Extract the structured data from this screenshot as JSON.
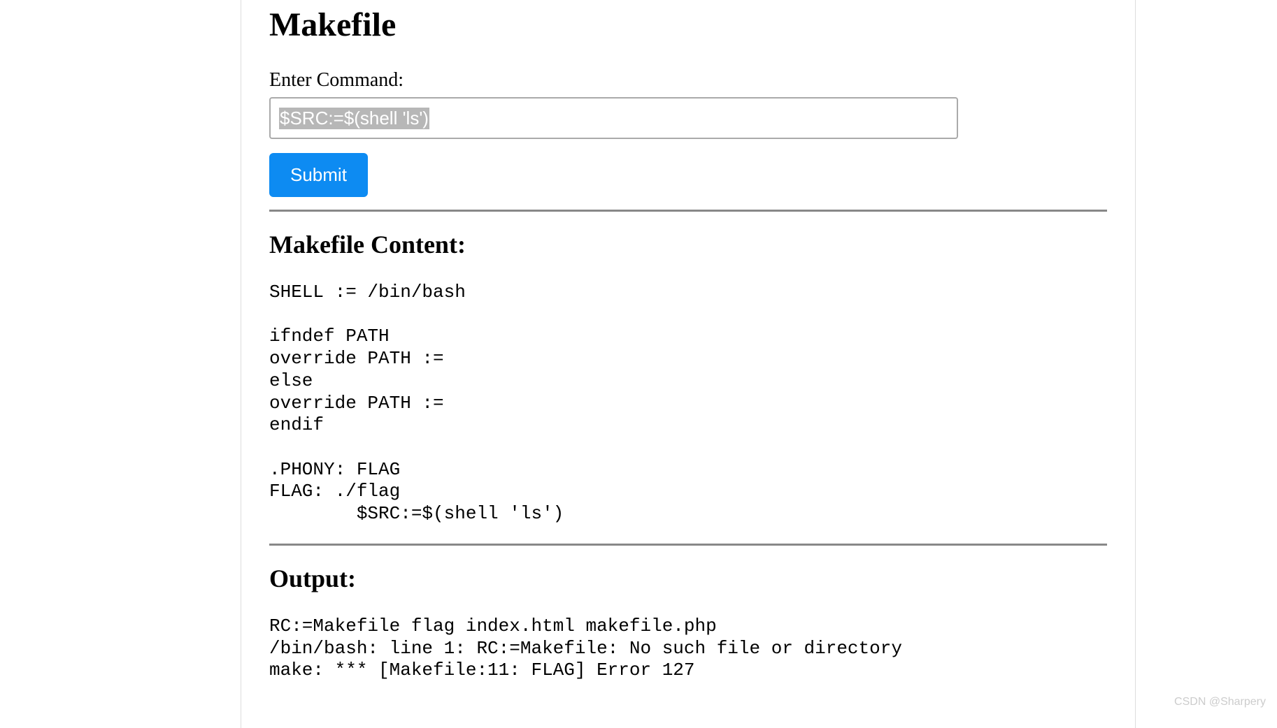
{
  "page": {
    "title": "Makefile",
    "label": "Enter Command:",
    "input_value": "$SRC:=$(shell 'ls')",
    "submit_label": "Submit"
  },
  "sections": {
    "content_heading": "Makefile Content:",
    "output_heading": "Output:"
  },
  "makefile_content": "SHELL := /bin/bash\n\nifndef PATH\noverride PATH :=\nelse\noverride PATH :=\nendif\n\n.PHONY: FLAG\nFLAG: ./flag\n        $SRC:=$(shell 'ls')",
  "output_content": "RC:=Makefile flag index.html makefile.php\n/bin/bash: line 1: RC:=Makefile: No such file or directory\nmake: *** [Makefile:11: FLAG] Error 127",
  "watermark": "CSDN @Sharpery"
}
